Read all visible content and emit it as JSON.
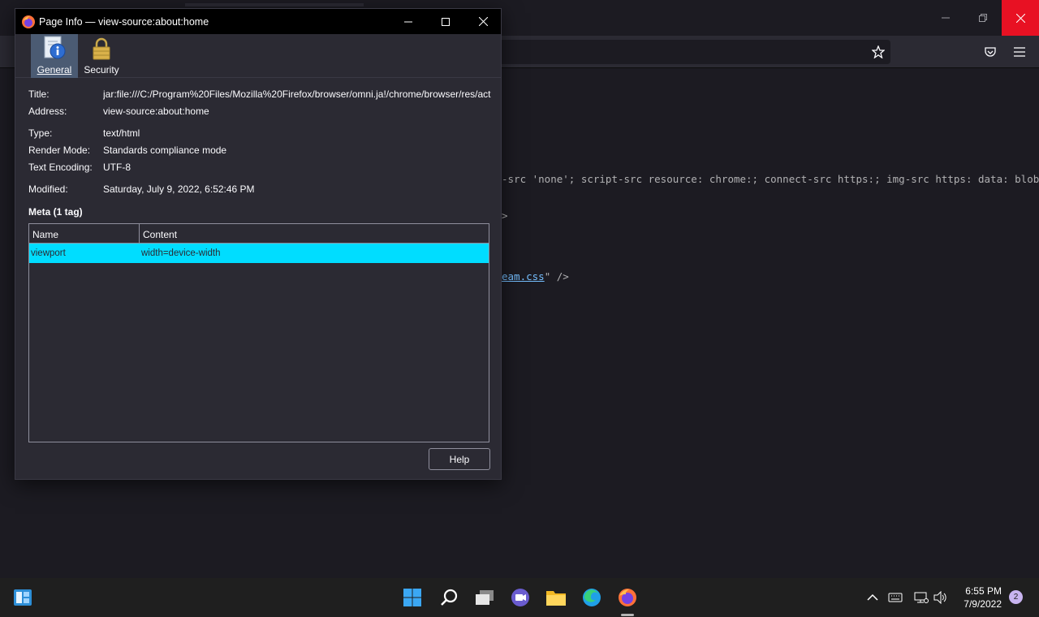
{
  "background": {
    "code_lines": [
      "-src 'none'; script-src resource: chrome:; connect-src https:; img-src https: data: blob: chrom",
      ">"
    ],
    "link_line": {
      "link": "eam.css",
      "suffix": "\" />"
    }
  },
  "dialog": {
    "title": "Page Info — view-source:about:home",
    "tabs": [
      {
        "label": "General",
        "selected": true
      },
      {
        "label": "Security",
        "selected": false
      }
    ],
    "fields": {
      "title": {
        "label": "Title:",
        "value": "jar:file:///C:/Program%20Files/Mozilla%20Firefox/browser/omni.ja!/chrome/browser/res/act"
      },
      "address": {
        "label": "Address:",
        "value": "view-source:about:home"
      },
      "type": {
        "label": "Type:",
        "value": "text/html"
      },
      "render_mode": {
        "label": "Render Mode:",
        "value": "Standards compliance mode"
      },
      "encoding": {
        "label": "Text Encoding:",
        "value": "UTF-8"
      },
      "modified": {
        "label": "Modified:",
        "value": "Saturday, July 9, 2022, 6:52:46 PM"
      }
    },
    "meta_heading": "Meta (1 tag)",
    "meta_table": {
      "columns": [
        "Name",
        "Content"
      ],
      "rows": [
        {
          "name": "viewport",
          "content": "width=device-width",
          "selected": true
        }
      ]
    },
    "help_label": "Help"
  },
  "taskbar": {
    "time": "6:55 PM",
    "date": "7/9/2022",
    "notification_count": "2"
  },
  "colors": {
    "selection": "#00ddff",
    "close_hover": "#e81123",
    "tab_selected": "#4b5b73"
  }
}
